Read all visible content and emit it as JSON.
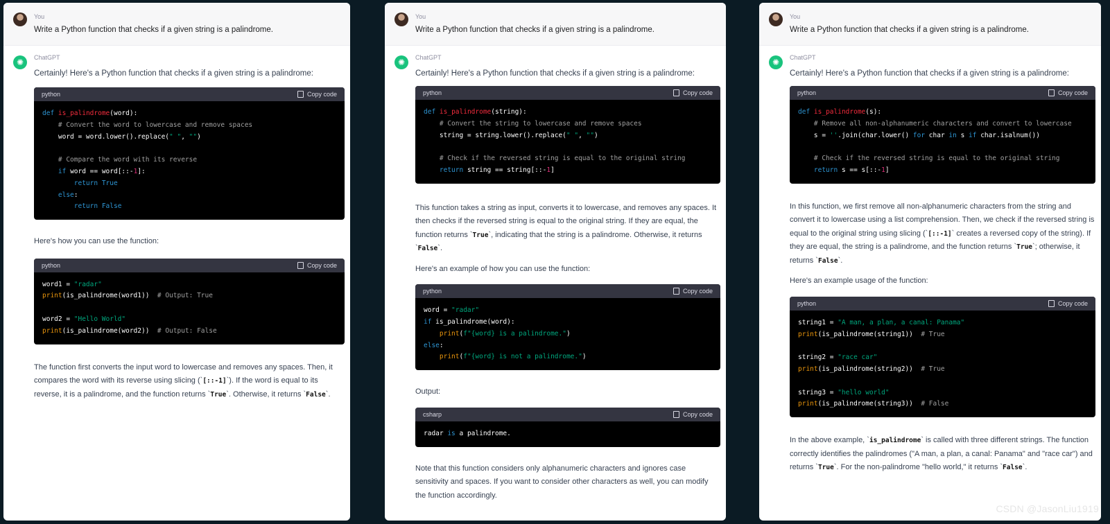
{
  "common": {
    "you_label": "You",
    "bot_label": "ChatGPT",
    "user_message": "Write a Python function that checks if a given string is a palindrome.",
    "intro": "Certainly! Here's a Python function that checks if a given string is a palindrome:",
    "copy_label": "Copy code"
  },
  "panel1": {
    "code1_lang": "python",
    "text_usage": "Here's how you can use the function:",
    "code2_lang": "python",
    "explain_a": "The function first converts the input word to lowercase and removes any spaces. Then, it compares the word with its reverse using slicing (`",
    "explain_code1": "[::-1]",
    "explain_b": "`). If the word is equal to its reverse, it is a palindrome, and the function returns `",
    "explain_code2": "True",
    "explain_c": "`. Otherwise, it returns `",
    "explain_code3": "False",
    "explain_d": "`."
  },
  "panel2": {
    "code1_lang": "python",
    "explain_a": "This function takes a string as input, converts it to lowercase, and removes any spaces. It then checks if the reversed string is equal to the original string. If they are equal, the function returns `",
    "explain_code1": "True",
    "explain_b": "`, indicating that the string is a palindrome. Otherwise, it returns `",
    "explain_code2": "False",
    "explain_c": "`.",
    "text_usage": "Here's an example of how you can use the function:",
    "code2_lang": "python",
    "output_label": "Output:",
    "code3_lang": "csharp",
    "note": "Note that this function considers only alphanumeric characters and ignores case sensitivity and spaces. If you want to consider other characters as well, you can modify the function accordingly."
  },
  "panel3": {
    "code1_lang": "python",
    "explain_a": "In this function, we first remove all non-alphanumeric characters from the string and convert it to lowercase using a list comprehension. Then, we check if the reversed string is equal to the original string using slicing (`",
    "explain_code1": "[::-1]",
    "explain_b": "` creates a reversed copy of the string). If they are equal, the string is a palindrome, and the function returns `",
    "explain_code2": "True",
    "explain_c": "`; otherwise, it returns `",
    "explain_code3": "False",
    "explain_d": "`.",
    "text_usage": "Here's an example usage of the function:",
    "code2_lang": "python",
    "final_a": "In the above example, `",
    "final_code1": "is_palindrome",
    "final_b": "` is called with three different strings. The function correctly identifies the palindromes (\"A man, a plan, a canal: Panama\" and \"race car\") and returns `",
    "final_code2": "True",
    "final_c": "`. For the non-palindrome \"hello world,\" it returns `",
    "final_code3": "False",
    "final_d": "`."
  },
  "watermark": "CSDN @JasonLiu1919"
}
